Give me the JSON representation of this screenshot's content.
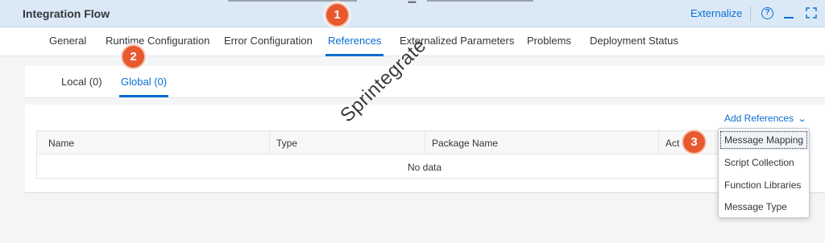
{
  "header": {
    "title": "Integration Flow",
    "externalize_label": "Externalize",
    "help_glyph": "?",
    "icons": [
      "help-icon",
      "minimize-icon",
      "fullscreen-icon"
    ]
  },
  "tabs": [
    {
      "label": "General"
    },
    {
      "label": "Runtime Configuration"
    },
    {
      "label": "Error Configuration"
    },
    {
      "label": "References",
      "active": true
    },
    {
      "label": "Externalized Parameters"
    },
    {
      "label": "Problems"
    },
    {
      "label": "Deployment Status"
    }
  ],
  "subtabs": [
    {
      "label": "Local (0)"
    },
    {
      "label": "Global (0)",
      "active": true
    }
  ],
  "toolbar": {
    "add_references_label": "Add References",
    "chevron": "⌄"
  },
  "table": {
    "columns": [
      "Name",
      "Type",
      "Package Name",
      "Act"
    ],
    "empty_text": "No data"
  },
  "menu": {
    "items": [
      "Message Mapping",
      "Script Collection",
      "Function Libraries",
      "Message Type"
    ],
    "focused_index": 0
  },
  "callouts": [
    "1",
    "2",
    "3"
  ],
  "watermark": "Sprintegrate",
  "colors": {
    "accent": "#0a6ed1",
    "header_bg": "#dbe9f7",
    "callout": "#e8592f"
  }
}
